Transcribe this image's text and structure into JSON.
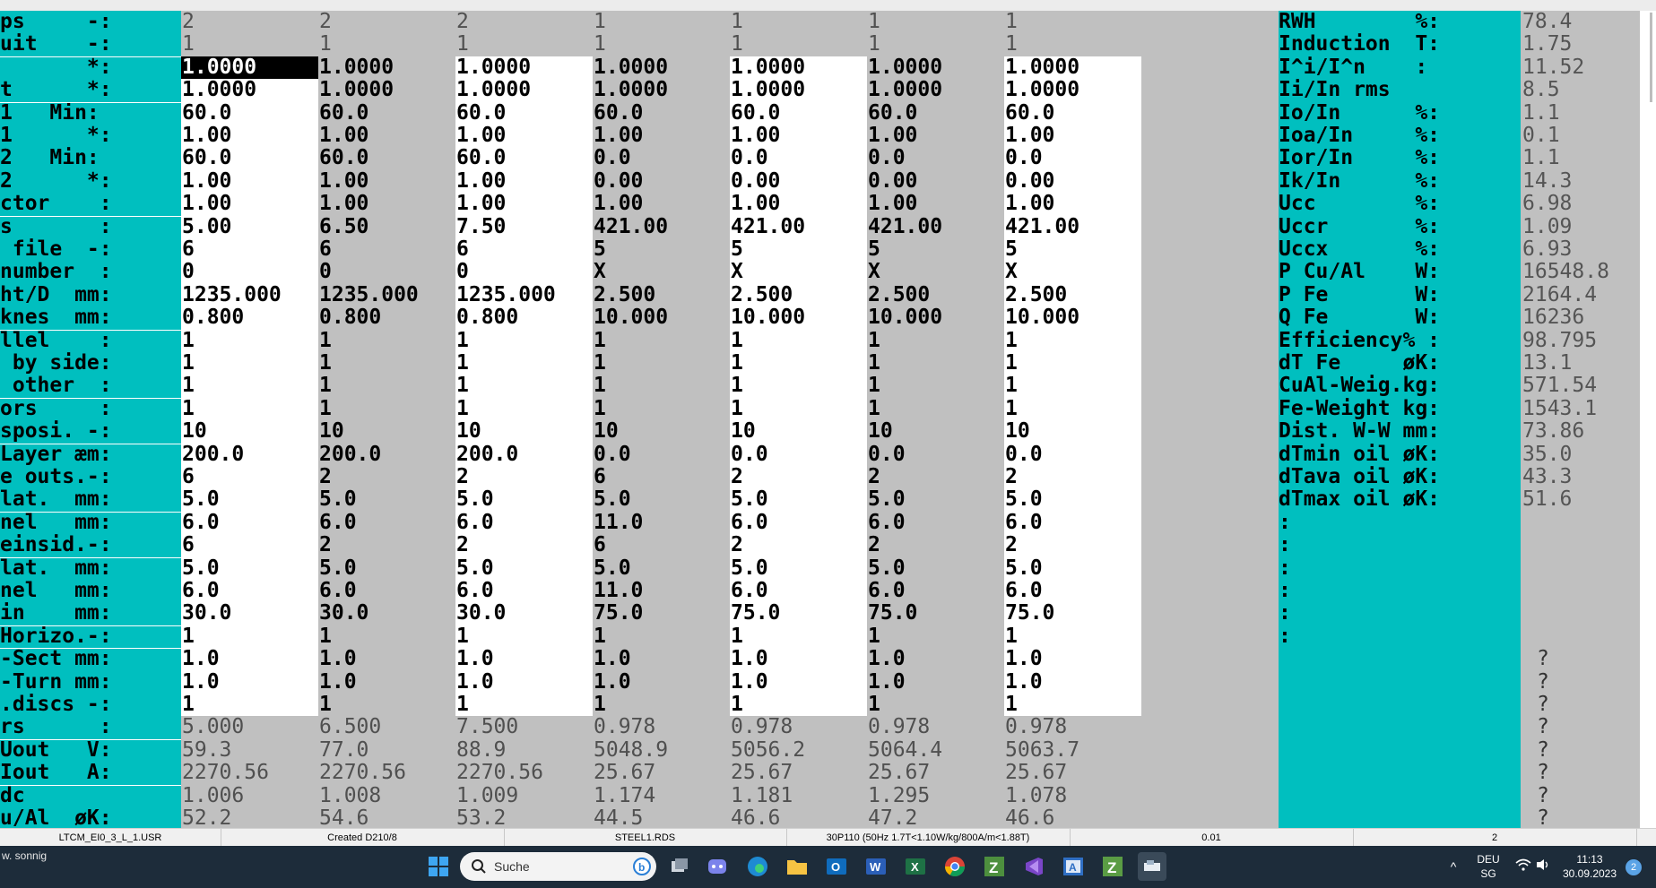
{
  "table": {
    "rows": [
      {
        "label": "ps     -:",
        "cells": [
          "2",
          "2",
          "2",
          "1",
          "1",
          "1",
          "1"
        ],
        "style": "gray",
        "right_label": "RWH        %:",
        "right_value": "78.4"
      },
      {
        "label": "uit    -:",
        "cells": [
          "1",
          "1",
          "1",
          "1",
          "1",
          "1",
          "1"
        ],
        "style": "gray",
        "right_label": "Induction  T:",
        "right_value": "1.75"
      },
      {
        "label": "       *:",
        "cells": [
          "1.0000",
          "1.0000",
          "1.0000",
          "1.0000",
          "1.0000",
          "1.0000",
          "1.0000"
        ],
        "style": "edit",
        "right_label": "I^i/I^n    :",
        "right_value": "11.52"
      },
      {
        "label": "t      *:",
        "cells": [
          "1.0000",
          "1.0000",
          "1.0000",
          "1.0000",
          "1.0000",
          "1.0000",
          "1.0000"
        ],
        "style": "edit",
        "right_label": "Ii/In rms   ",
        "right_value": "8.5"
      },
      {
        "label": "1   Min:",
        "cells": [
          "60.0",
          "60.0",
          "60.0",
          "60.0",
          "60.0",
          "60.0",
          "60.0"
        ],
        "style": "edit",
        "right_label": "Io/In      %:",
        "right_value": "1.1"
      },
      {
        "label": "1      *:",
        "cells": [
          "1.00",
          "1.00",
          "1.00",
          "1.00",
          "1.00",
          "1.00",
          "1.00"
        ],
        "style": "edit",
        "right_label": "Ioa/In     %:",
        "right_value": "0.1"
      },
      {
        "label": "2   Min:",
        "cells": [
          "60.0",
          "60.0",
          "60.0",
          "0.0",
          "0.0",
          "0.0",
          "0.0"
        ],
        "style": "edit",
        "right_label": "Ior/In     %:",
        "right_value": "1.1"
      },
      {
        "label": "2      *:",
        "cells": [
          "1.00",
          "1.00",
          "1.00",
          "0.00",
          "0.00",
          "0.00",
          "0.00"
        ],
        "style": "edit",
        "right_label": "Ik/In      %:",
        "right_value": "14.3"
      },
      {
        "label": "ctor    :",
        "cells": [
          "1.00",
          "1.00",
          "1.00",
          "1.00",
          "1.00",
          "1.00",
          "1.00"
        ],
        "style": "edit",
        "right_label": "Ucc        %:",
        "right_value": "6.98"
      },
      {
        "label": "s       :",
        "cells": [
          "5.00",
          "6.50",
          "7.50",
          "421.00",
          "421.00",
          "421.00",
          "421.00"
        ],
        "style": "edit",
        "right_label": "Uccr       %:",
        "right_value": "1.09"
      },
      {
        "label": " file  -:",
        "cells": [
          "6",
          "6",
          "6",
          "5",
          "5",
          "5",
          "5"
        ],
        "style": "edit",
        "right_label": "Uccx       %:",
        "right_value": "6.93"
      },
      {
        "label": "number  :",
        "cells": [
          "0",
          "0",
          "0",
          "X",
          "X",
          "X",
          "X"
        ],
        "style": "edit",
        "right_label": "P Cu/Al    W:",
        "right_value": "16548.8"
      },
      {
        "label": "ht/D  mm:",
        "cells": [
          "1235.000",
          "1235.000",
          "1235.000",
          "2.500",
          "2.500",
          "2.500",
          "2.500"
        ],
        "style": "edit",
        "right_label": "P Fe       W:",
        "right_value": "2164.4"
      },
      {
        "label": "knes  mm:",
        "cells": [
          "0.800",
          "0.800",
          "0.800",
          "10.000",
          "10.000",
          "10.000",
          "10.000"
        ],
        "style": "edit",
        "right_label": "Q Fe       W:",
        "right_value": "16236"
      },
      {
        "label": "llel    :",
        "cells": [
          "1",
          "1",
          "1",
          "1",
          "1",
          "1",
          "1"
        ],
        "style": "edit",
        "right_label": "Efficiency% :",
        "right_value": "98.795"
      },
      {
        "label": " by side:",
        "cells": [
          "1",
          "1",
          "1",
          "1",
          "1",
          "1",
          "1"
        ],
        "style": "edit",
        "right_label": "dT Fe     øK:",
        "right_value": "13.1"
      },
      {
        "label": " other  :",
        "cells": [
          "1",
          "1",
          "1",
          "1",
          "1",
          "1",
          "1"
        ],
        "style": "edit",
        "right_label": "CuAl-Weig.kg:",
        "right_value": "571.54"
      },
      {
        "label": "ors     :",
        "cells": [
          "1",
          "1",
          "1",
          "1",
          "1",
          "1",
          "1"
        ],
        "style": "edit",
        "right_label": "Fe-Weight kg:",
        "right_value": "1543.1"
      },
      {
        "label": "sposi. -:",
        "cells": [
          "10",
          "10",
          "10",
          "10",
          "10",
          "10",
          "10"
        ],
        "style": "edit",
        "right_label": "Dist. W-W mm:",
        "right_value": "73.86"
      },
      {
        "label": "Layer æm:",
        "cells": [
          "200.0",
          "200.0",
          "200.0",
          "0.0",
          "0.0",
          "0.0",
          "0.0"
        ],
        "style": "edit",
        "right_label": "dTmin oil øK:",
        "right_value": "35.0"
      },
      {
        "label": "e outs.-:",
        "cells": [
          "6",
          "2",
          "2",
          "6",
          "2",
          "2",
          "2"
        ],
        "style": "edit",
        "right_label": "dTava oil øK:",
        "right_value": "43.3"
      },
      {
        "label": "lat.  mm:",
        "cells": [
          "5.0",
          "5.0",
          "5.0",
          "5.0",
          "5.0",
          "5.0",
          "5.0"
        ],
        "style": "edit",
        "right_label": "dTmax oil øK:",
        "right_value": "51.6"
      },
      {
        "label": "nel   mm:",
        "cells": [
          "6.0",
          "6.0",
          "6.0",
          "11.0",
          "6.0",
          "6.0",
          "6.0"
        ],
        "style": "edit",
        "right_label": ":",
        "right_value": ""
      },
      {
        "label": "einsid.-:",
        "cells": [
          "6",
          "2",
          "2",
          "6",
          "2",
          "2",
          "2"
        ],
        "style": "edit",
        "right_label": ":",
        "right_value": ""
      },
      {
        "label": "lat.  mm:",
        "cells": [
          "5.0",
          "5.0",
          "5.0",
          "5.0",
          "5.0",
          "5.0",
          "5.0"
        ],
        "style": "edit",
        "right_label": ":",
        "right_value": ""
      },
      {
        "label": "nel   mm:",
        "cells": [
          "6.0",
          "6.0",
          "6.0",
          "11.0",
          "6.0",
          "6.0",
          "6.0"
        ],
        "style": "edit",
        "right_label": ":",
        "right_value": ""
      },
      {
        "label": "in    mm:",
        "cells": [
          "30.0",
          "30.0",
          "30.0",
          "75.0",
          "75.0",
          "75.0",
          "75.0"
        ],
        "style": "edit",
        "right_label": ":",
        "right_value": ""
      },
      {
        "label": "Horizo.-:",
        "cells": [
          "1",
          "1",
          "1",
          "1",
          "1",
          "1",
          "1"
        ],
        "style": "edit",
        "right_label": ":",
        "right_value": ""
      },
      {
        "label": "-Sect mm:",
        "cells": [
          "1.0",
          "1.0",
          "1.0",
          "1.0",
          "1.0",
          "1.0",
          "1.0"
        ],
        "style": "edit",
        "right_label": "",
        "right_value": "?"
      },
      {
        "label": "-Turn mm:",
        "cells": [
          "1.0",
          "1.0",
          "1.0",
          "1.0",
          "1.0",
          "1.0",
          "1.0"
        ],
        "style": "edit",
        "right_label": "",
        "right_value": "?"
      },
      {
        "label": ".discs -:",
        "cells": [
          "1",
          "1",
          "1",
          "1",
          "1",
          "1",
          "1"
        ],
        "style": "edit",
        "right_label": "",
        "right_value": "?"
      },
      {
        "label": "rs      :",
        "cells": [
          "5.000",
          "6.500",
          "7.500",
          "0.978",
          "0.978",
          "0.978",
          "0.978"
        ],
        "style": "gray",
        "right_label": "",
        "right_value": "?"
      },
      {
        "label": "Uout   V:",
        "cells": [
          "59.3",
          "77.0",
          "88.9",
          "5048.9",
          "5056.2",
          "5064.4",
          "5063.7"
        ],
        "style": "gray",
        "right_label": "",
        "right_value": "?"
      },
      {
        "label": "Iout   A:",
        "cells": [
          "2270.56",
          "2270.56",
          "2270.56",
          "25.67",
          "25.67",
          "25.67",
          "25.67"
        ],
        "style": "gray",
        "right_label": "",
        "right_value": "?"
      },
      {
        "label": "dc       ",
        "cells": [
          "1.006",
          "1.008",
          "1.009",
          "1.174",
          "1.181",
          "1.295",
          "1.078"
        ],
        "style": "gray",
        "right_label": "",
        "right_value": "?"
      },
      {
        "label": "u/Al  øK:",
        "cells": [
          "52.2",
          "54.6",
          "53.2",
          "44.5",
          "46.6",
          "47.2",
          "46.6"
        ],
        "style": "gray",
        "right_label": "",
        "right_value": "?"
      }
    ]
  },
  "status_bar": {
    "segments": [
      "LTCM_EI0_3_L_1.USR",
      "Created D210/8",
      "STEEL1.RDS",
      "30P110 (50Hz 1.7T<1.10W/kg/800A/m<1.88T)",
      "0.01",
      "2"
    ]
  },
  "taskbar": {
    "weather_line1": "",
    "weather_line2": "w. sonnig",
    "search_placeholder": "Suche",
    "apps": [
      "windows-start-icon",
      "search-icon",
      "task-view-icon",
      "teams-icon",
      "edge-icon",
      "file-explorer-icon",
      "outlook-icon",
      "word-icon",
      "excel-icon",
      "chrome-icon",
      "z-app-icon",
      "visual-studio-icon",
      "a-app-icon",
      "z-app-icon",
      "active-app-icon"
    ],
    "language_top": "DEU",
    "language_bottom": "SG",
    "time": "11:13",
    "date": "30.09.2023",
    "notification_count": "2"
  },
  "colors": {
    "label_bg": "#00bfbf",
    "grid_gray": "#c0c0c0",
    "grid_white": "#ffffff",
    "taskbar_bg": "#1d2c3a"
  }
}
